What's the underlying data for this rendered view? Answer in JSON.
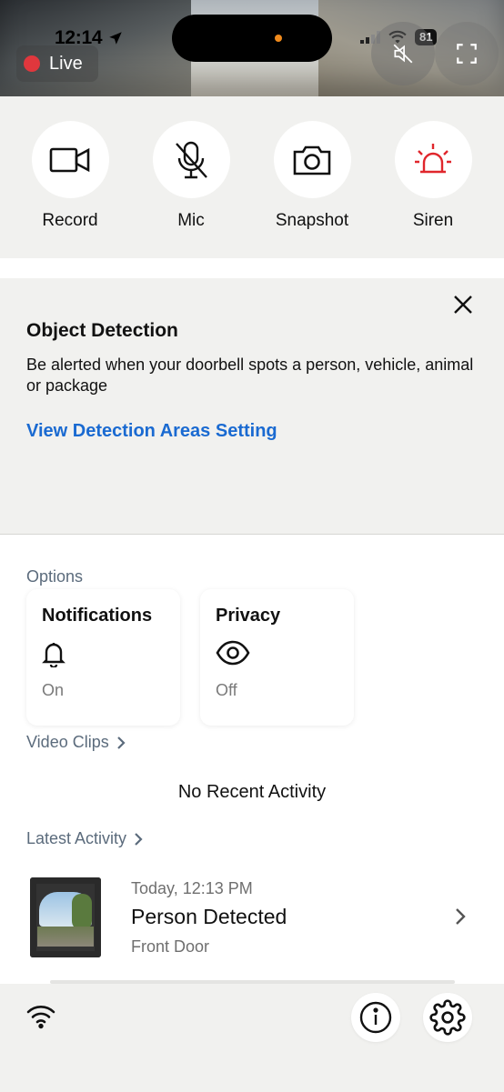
{
  "status_bar": {
    "time": "12:14",
    "battery": "81"
  },
  "camera": {
    "live_label": "Live"
  },
  "actions": [
    {
      "label": "Record"
    },
    {
      "label": "Mic"
    },
    {
      "label": "Snapshot"
    },
    {
      "label": "Siren"
    }
  ],
  "object_detection": {
    "title": "Object Detection",
    "body": "Be alerted when your doorbell spots a person, vehicle, animal or package",
    "link": "View Detection Areas Setting"
  },
  "options": {
    "label": "Options",
    "notifications": {
      "title": "Notifications",
      "value": "On"
    },
    "privacy": {
      "title": "Privacy",
      "value": "Off"
    }
  },
  "video_clips": {
    "label": "Video Clips",
    "empty_text": "No Recent Activity"
  },
  "latest_activity": {
    "label": "Latest Activity",
    "item": {
      "time": "Today, 12:13 PM",
      "title": "Person Detected",
      "location": "Front Door"
    }
  },
  "colors": {
    "accent_blue": "#1a6ad1",
    "siren_red": "#e0262c",
    "live_red": "#e0373d"
  }
}
